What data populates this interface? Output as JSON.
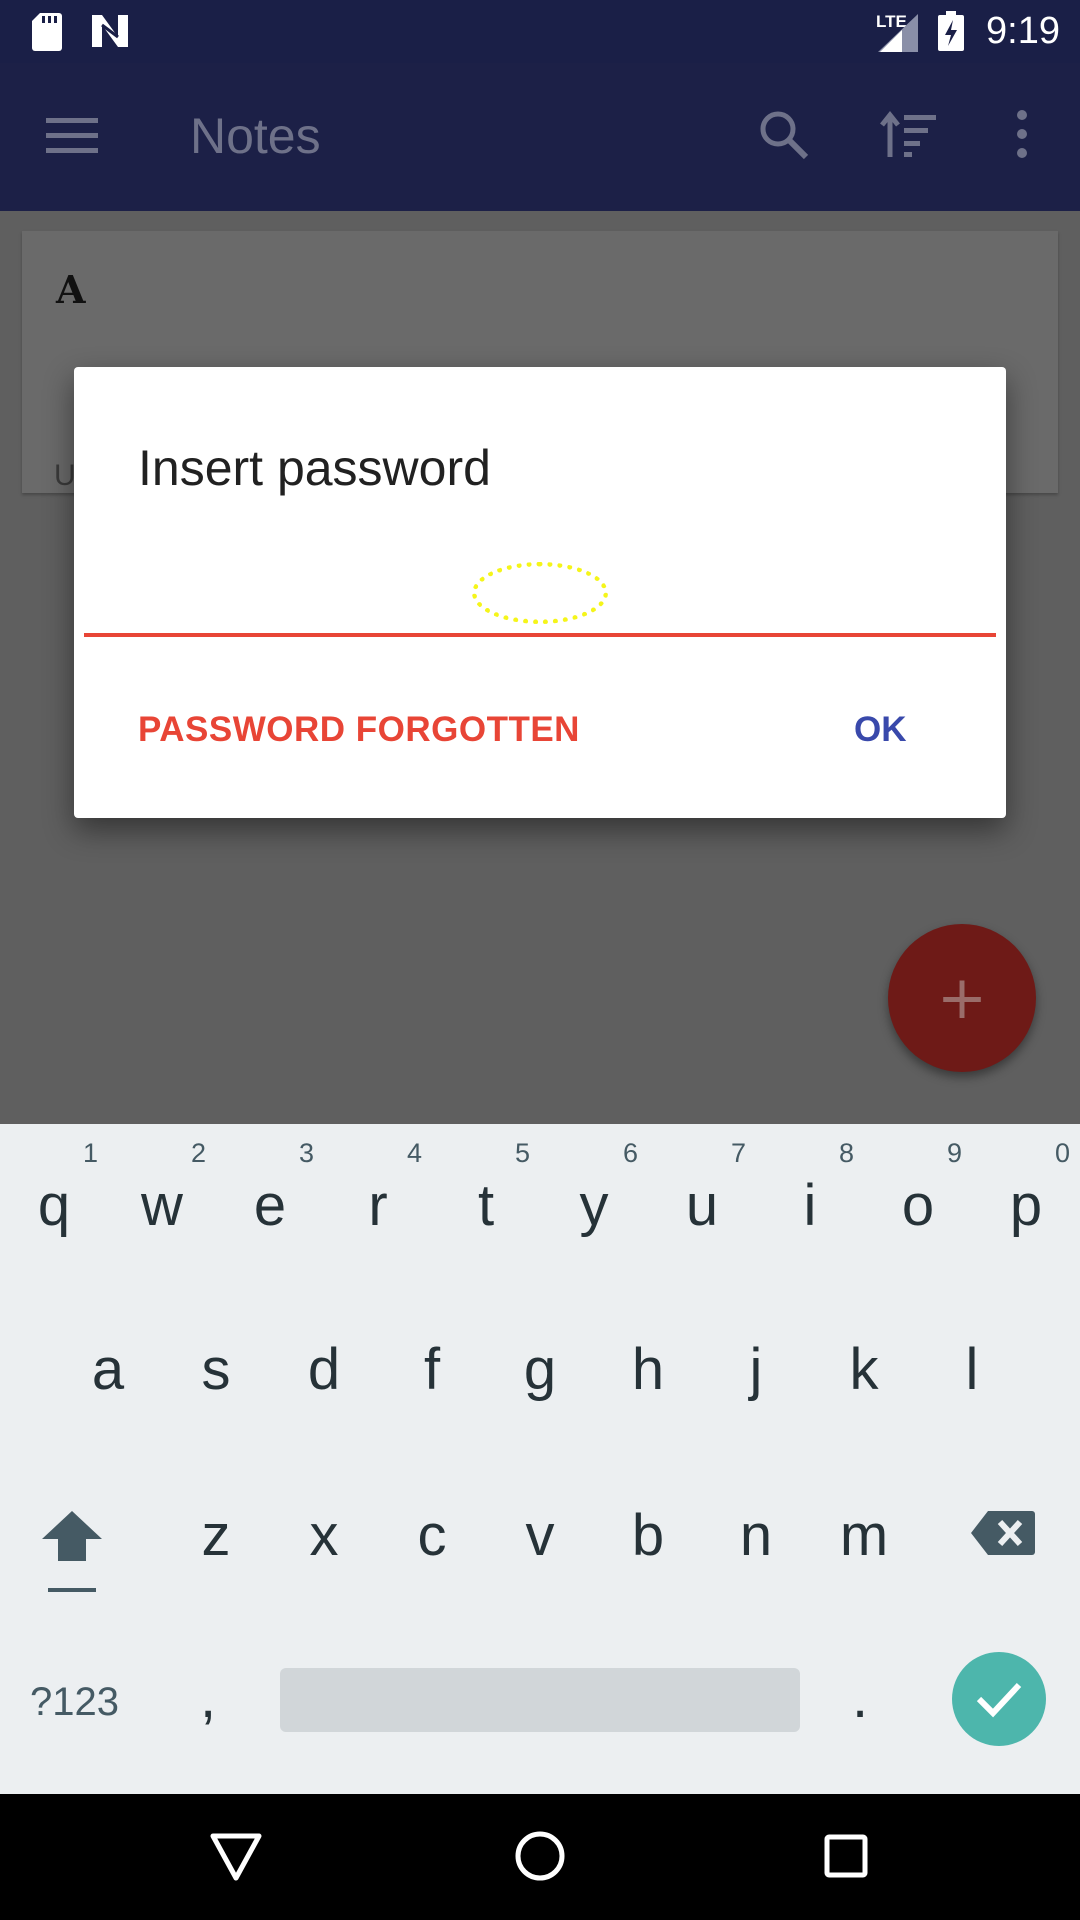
{
  "status_bar": {
    "network": "LTE",
    "time": "9:19"
  },
  "toolbar": {
    "title": "Notes"
  },
  "note": {
    "title": "A",
    "subtitle": "U"
  },
  "fab": {
    "label": "+"
  },
  "dialog": {
    "title": "Insert password",
    "input_value": "",
    "forgot_label": "PASSWORD FORGOTTEN",
    "ok_label": "OK"
  },
  "keyboard": {
    "row1": [
      {
        "key": "q",
        "hint": "1"
      },
      {
        "key": "w",
        "hint": "2"
      },
      {
        "key": "e",
        "hint": "3"
      },
      {
        "key": "r",
        "hint": "4"
      },
      {
        "key": "t",
        "hint": "5"
      },
      {
        "key": "y",
        "hint": "6"
      },
      {
        "key": "u",
        "hint": "7"
      },
      {
        "key": "i",
        "hint": "8"
      },
      {
        "key": "o",
        "hint": "9"
      },
      {
        "key": "p",
        "hint": "0"
      }
    ],
    "row2": [
      "a",
      "s",
      "d",
      "f",
      "g",
      "h",
      "j",
      "k",
      "l"
    ],
    "row3": [
      "z",
      "x",
      "c",
      "v",
      "b",
      "n",
      "m"
    ],
    "symbols_label": "?123",
    "comma": ",",
    "period": "."
  },
  "colors": {
    "accent_red": "#e84536",
    "primary_blue": "#3949ab",
    "teal": "#4db6ac",
    "statusbar": "#1a1f47"
  },
  "icons": [
    "sd-card-icon",
    "n-logo-icon",
    "signal-icon",
    "battery-charging-icon",
    "menu-icon",
    "search-icon",
    "sort-icon",
    "more-vert-icon",
    "shift-icon",
    "backspace-icon",
    "check-icon",
    "back-icon",
    "home-icon",
    "recent-apps-icon"
  ]
}
